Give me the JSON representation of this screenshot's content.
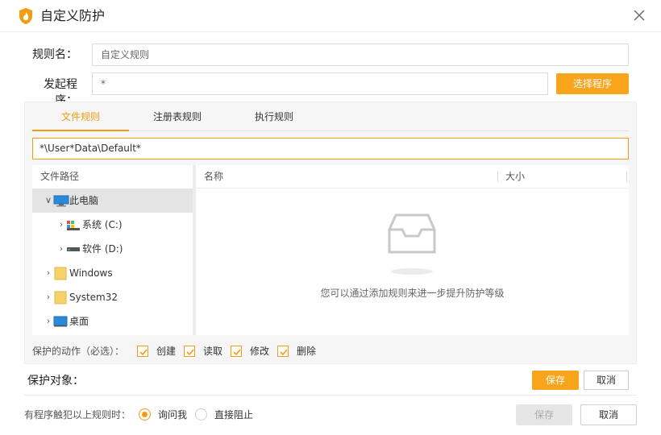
{
  "window": {
    "title": "自定义防护"
  },
  "form": {
    "rule_name_label": "规则名：",
    "rule_name_value": "自定义规则",
    "program_label": "发起程序：",
    "program_value": "*",
    "select_program_button": "选择程序"
  },
  "tabs": [
    {
      "label": "文件规则",
      "active": true
    },
    {
      "label": "注册表规则",
      "active": false
    },
    {
      "label": "执行规则",
      "active": false
    }
  ],
  "path_value": "*\\User*Data\\Default*",
  "tree": {
    "header": "文件路径",
    "items": [
      {
        "label": "此电脑",
        "icon": "computer-icon",
        "expanded": true,
        "selected": true
      },
      {
        "label": "系统 (C:)",
        "icon": "system-drive-icon",
        "expanded": false
      },
      {
        "label": "软件 (D:)",
        "icon": "drive-icon",
        "expanded": false
      },
      {
        "label": "Windows",
        "icon": "folder-icon",
        "expanded": false
      },
      {
        "label": "System32",
        "icon": "folder-icon",
        "expanded": false
      },
      {
        "label": "桌面",
        "icon": "desktop-icon",
        "expanded": false
      }
    ]
  },
  "list": {
    "columns": [
      "名称",
      "大小"
    ],
    "empty_text": "您可以通过添加规则来进一步提升防护等级"
  },
  "actions": {
    "label": "保护的动作（必选）：",
    "items": [
      {
        "label": "创建",
        "checked": true
      },
      {
        "label": "读取",
        "checked": true
      },
      {
        "label": "修改",
        "checked": true
      },
      {
        "label": "删除",
        "checked": true
      }
    ]
  },
  "target": {
    "label": "保护对象：",
    "save_button": "保存",
    "cancel_button": "取消"
  },
  "trigger": {
    "label": "有程序触犯以上规则时：",
    "options": [
      {
        "label": "询问我",
        "selected": true
      },
      {
        "label": "直接阻止",
        "selected": false
      }
    ]
  },
  "footer": {
    "save_button": "保存",
    "cancel_button": "取消"
  },
  "colors": {
    "accent": "#f39b12",
    "button_orange": "#f8a51c",
    "panel_bg": "#f6f6f6",
    "selected_row": "#e4e4e4"
  }
}
